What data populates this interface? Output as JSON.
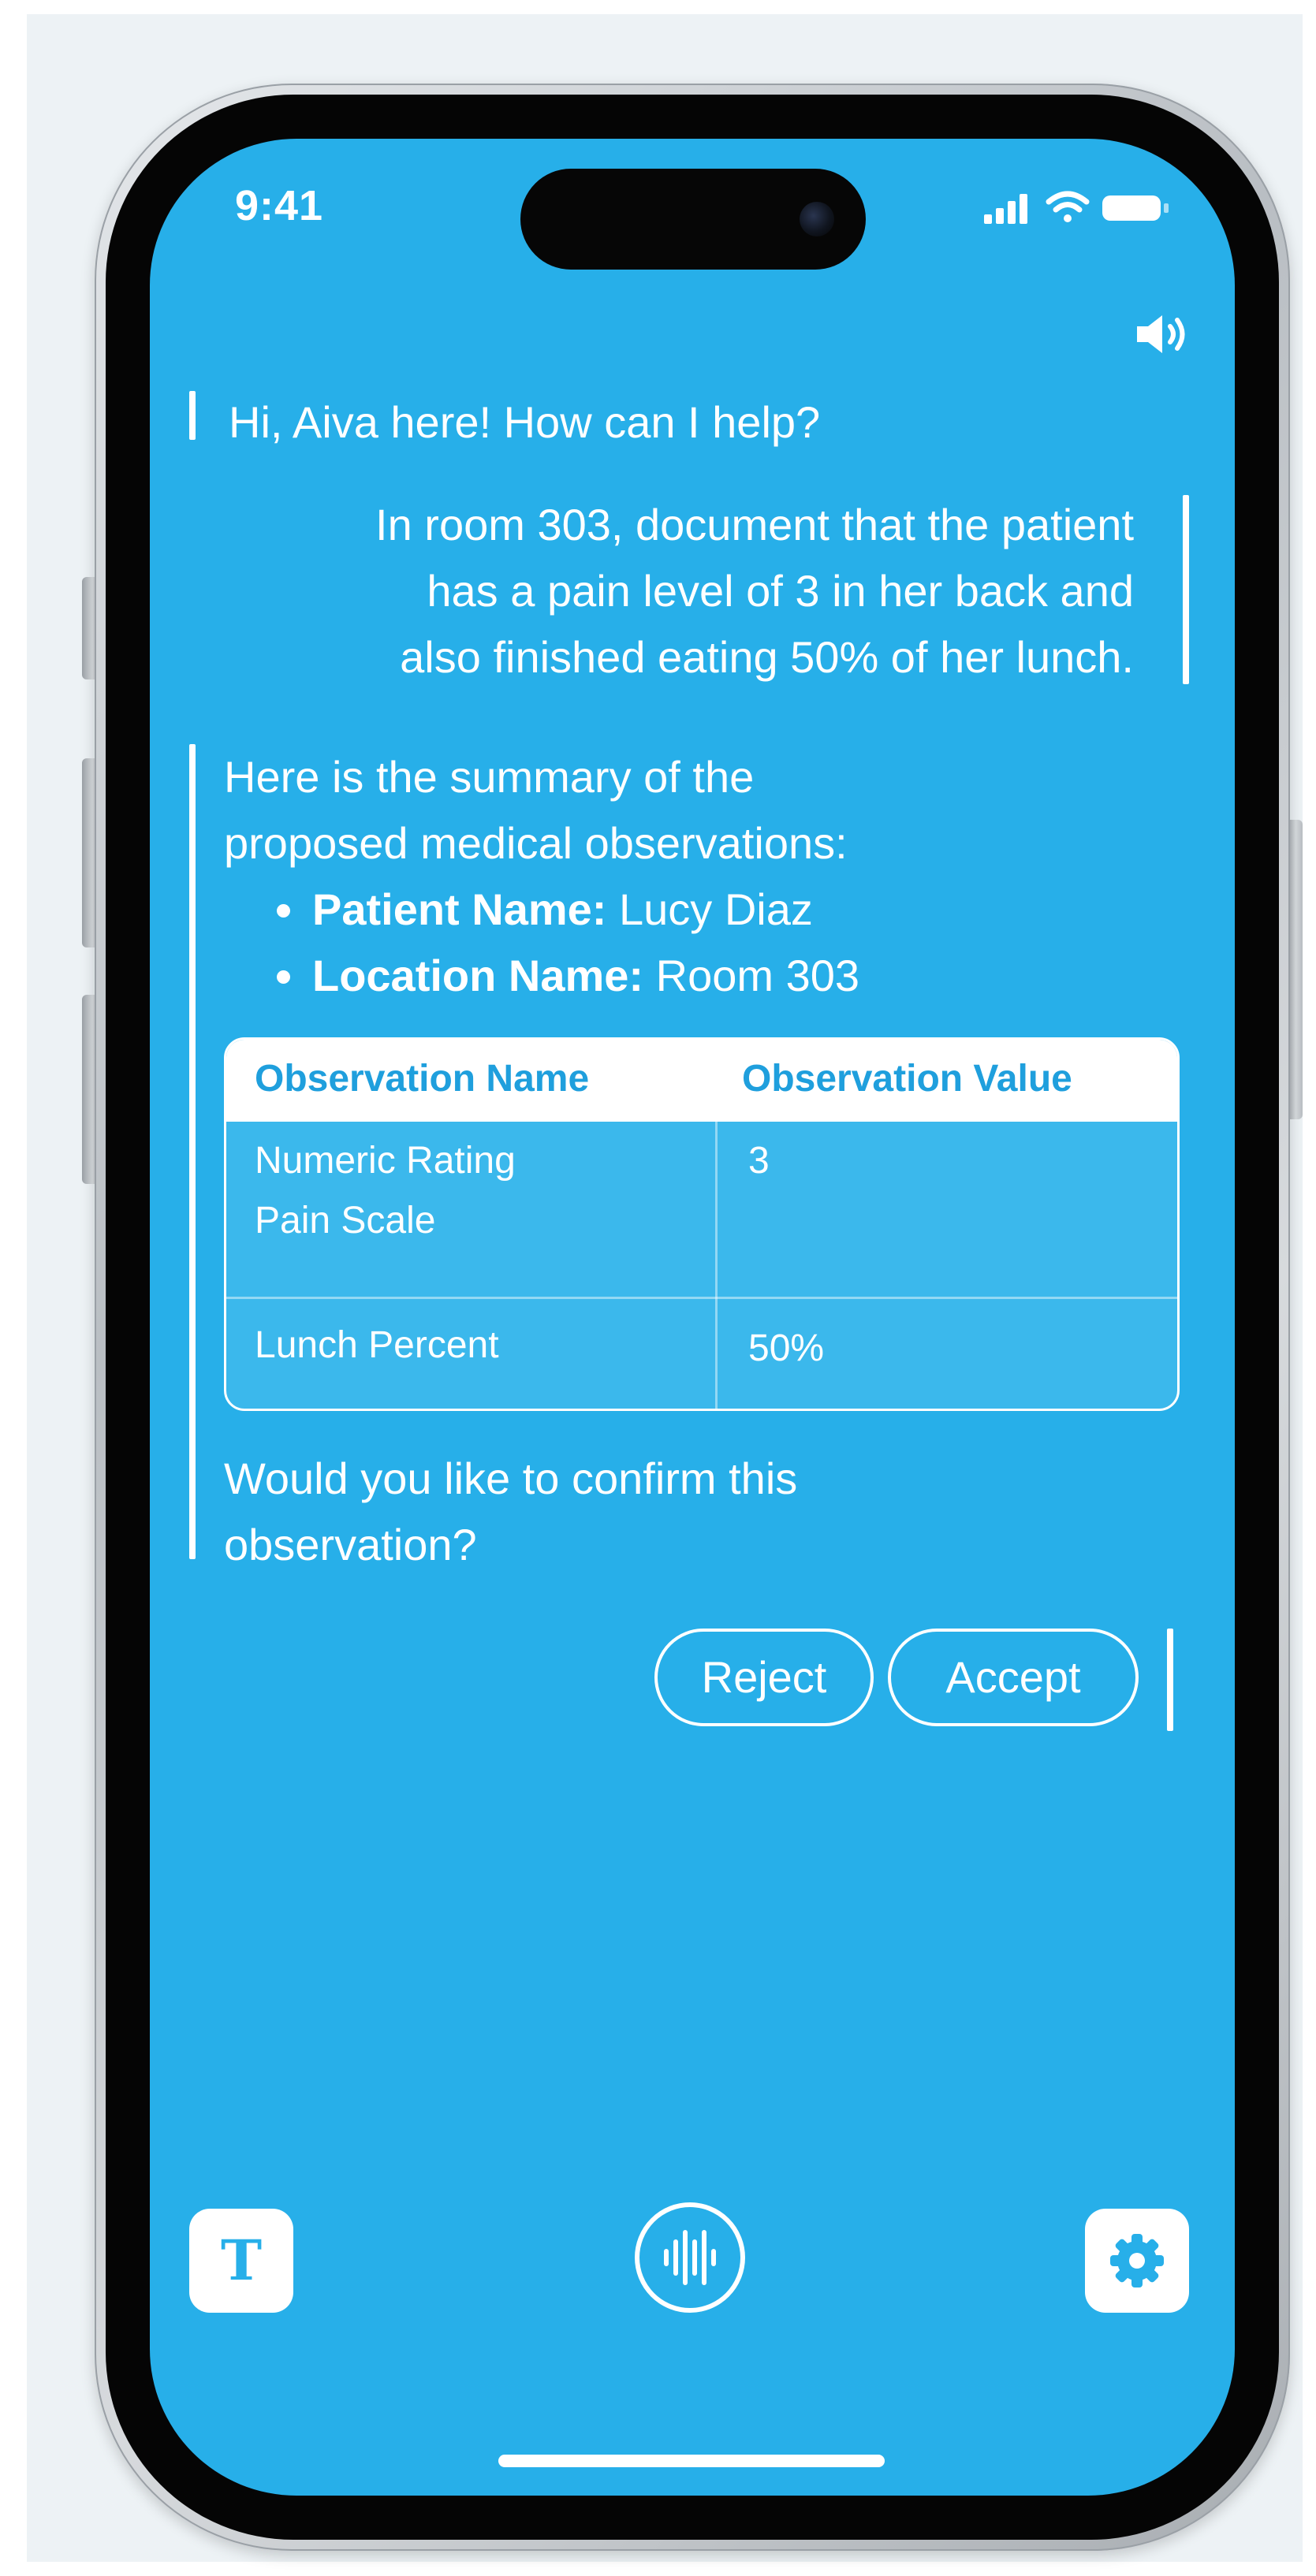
{
  "status_bar": {
    "time": "9:41",
    "icons": [
      "signal-icon",
      "wifi-icon",
      "battery-icon"
    ]
  },
  "header": {
    "speaker_icon": "speaker-icon"
  },
  "conversation": {
    "greeting": "Hi, Aiva here! How can I help?",
    "user_message_lines": [
      "In room 303, document that the patient",
      "has a pain level of 3 in her back and",
      "also finished eating 50% of her lunch."
    ],
    "assistant_intro_lines": [
      "Here is the summary of the",
      "proposed medical observations:"
    ],
    "summary_items": [
      {
        "label": "Patient Name:",
        "value": "Lucy Diaz"
      },
      {
        "label": "Location Name:",
        "value": "Room 303"
      }
    ],
    "table": {
      "headers": [
        "Observation Name",
        "Observation Value"
      ],
      "rows": [
        {
          "name_lines": [
            "Numeric Rating",
            "Pain Scale"
          ],
          "value": "3"
        },
        {
          "name_lines": [
            "Lunch Percent"
          ],
          "value": "50%"
        }
      ]
    },
    "confirm_lines": [
      "Would you like to confirm this",
      "observation?"
    ],
    "actions": {
      "reject_label": "Reject",
      "accept_label": "Accept"
    }
  },
  "toolbar": {
    "text_button_glyph": "T",
    "text_icon": "text-input-icon",
    "voice_icon": "voice-waveform-icon",
    "settings_icon": "gear-icon"
  },
  "colors": {
    "screen_background": "#27afe9",
    "table_header_text": "#1f9fdd",
    "foreground": "#ffffff"
  }
}
